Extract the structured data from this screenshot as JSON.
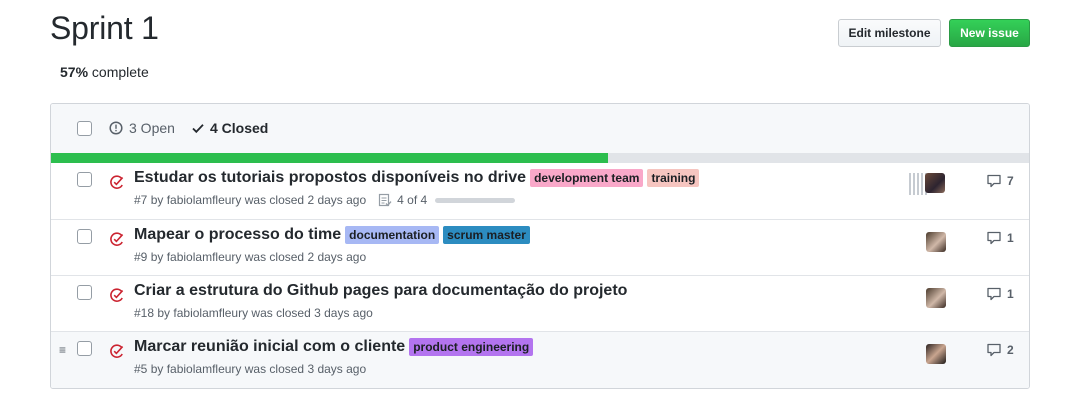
{
  "milestone": {
    "title": "Sprint 1",
    "progress_percent": "57%",
    "progress_suffix": "complete",
    "progress_fraction": 0.57
  },
  "actions": {
    "edit_label": "Edit milestone",
    "new_label": "New issue"
  },
  "filters": {
    "open_label": "3 Open",
    "closed_label": "4 Closed"
  },
  "colors": {
    "progress_fill": "#2cbe4e",
    "closed_icon": "#cb2431",
    "new_issue_button": "#28a745"
  },
  "issues": [
    {
      "title": "Estudar os tutoriais propostos disponíveis no drive",
      "number": "#7",
      "meta": "by fabiolamfleury was closed 2 days ago",
      "labels": [
        {
          "name": "development team",
          "color": "#f9a8c9"
        },
        {
          "name": "training",
          "color": "#f6c5c0"
        }
      ],
      "tasks": "4 of 4",
      "comments": "7",
      "icon": "closed-issue-icon"
    },
    {
      "title": "Mapear o processo do time",
      "number": "#9",
      "meta": "by fabiolamfleury was closed 2 days ago",
      "labels": [
        {
          "name": "documentation",
          "color": "#a7b8f4"
        },
        {
          "name": "scrum master",
          "color": "#2c8cc0"
        }
      ],
      "comments": "1",
      "icon": "closed-issue-icon"
    },
    {
      "title": "Criar a estrutura do Github pages para documentação do projeto",
      "number": "#18",
      "meta": "by fabiolamfleury was closed 3 days ago",
      "labels": [],
      "comments": "1",
      "icon": "closed-issue-icon"
    },
    {
      "title": "Marcar reunião inicial com o cliente",
      "number": "#5",
      "meta": "by fabiolamfleury was closed 3 days ago",
      "labels": [
        {
          "name": "product engineering",
          "color": "#b374ef"
        }
      ],
      "comments": "2",
      "icon": "closed-issue-icon"
    }
  ]
}
